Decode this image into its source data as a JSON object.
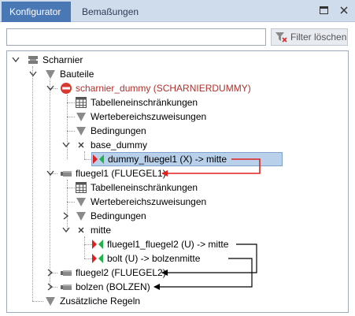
{
  "tabs": [
    {
      "label": "Konfigurator",
      "active": true
    },
    {
      "label": "Bemaßungen",
      "active": false
    }
  ],
  "filter": {
    "placeholder": "",
    "value": "",
    "button_label": "Filter löschen"
  },
  "tree": {
    "root": "Scharnier",
    "bauteile": "Bauteile",
    "scharnier_dummy": "scharnier_dummy (SCHARNIERDUMMY)",
    "tabellen1": "Tabelleneinschränkungen",
    "werte1": "Wertebereichszuweisungen",
    "bedingungen1": "Bedingungen",
    "base_dummy": "base_dummy",
    "dummy_fluegel1": "dummy_fluegel1 (X) -> mitte",
    "fluegel1": "fluegel1 (FLUEGEL1)",
    "tabellen2": "Tabelleneinschränkungen",
    "werte2": "Wertebereichszuweisungen",
    "bedingungen2": "Bedingungen",
    "mitte": "mitte",
    "fluegel1_fluegel2": "fluegel1_fluegel2 (U) -> mitte",
    "bolt": "bolt (U) -> bolzenmitte",
    "fluegel2": "fluegel2 (FLUEGEL2)",
    "bolzen": "bolzen (BOLZEN)",
    "zusaetzliche": "Zusätzliche Regeln"
  },
  "colors": {
    "tab_active": "#4a78b5",
    "tabbar": "#cfdcec",
    "selection": "#b9d0ea",
    "red_label": "#b0302c",
    "arrow_red": "#e02020",
    "constraint_red": "#e02020",
    "constraint_green": "#22b14c"
  }
}
